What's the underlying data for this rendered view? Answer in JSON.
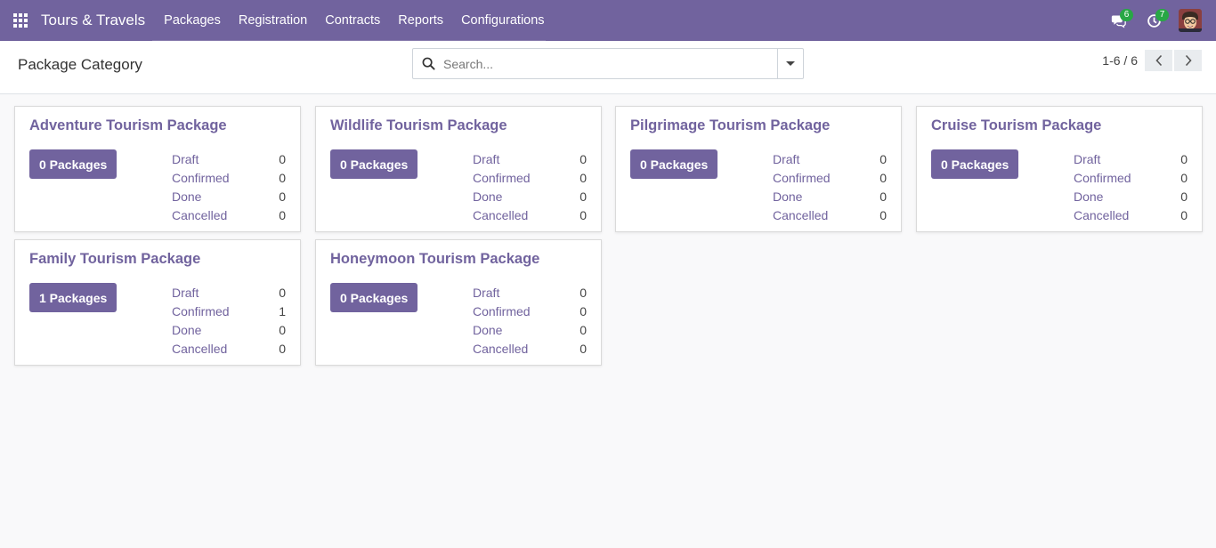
{
  "navbar": {
    "brand": "Tours & Travels",
    "menu": [
      "Packages",
      "Registration",
      "Contracts",
      "Reports",
      "Configurations"
    ],
    "messages_badge": "6",
    "activities_badge": "7"
  },
  "control_panel": {
    "title": "Package Category",
    "search_placeholder": "Search...",
    "pager": "1-6 / 6"
  },
  "stat_labels": {
    "draft": "Draft",
    "confirmed": "Confirmed",
    "done": "Done",
    "cancelled": "Cancelled"
  },
  "cards": [
    {
      "title": "Adventure Tourism Package",
      "button": "0 Packages",
      "draft": "0",
      "confirmed": "0",
      "done": "0",
      "cancelled": "0"
    },
    {
      "title": "Wildlife Tourism Package",
      "button": "0 Packages",
      "draft": "0",
      "confirmed": "0",
      "done": "0",
      "cancelled": "0"
    },
    {
      "title": "Pilgrimage Tourism Package",
      "button": "0 Packages",
      "draft": "0",
      "confirmed": "0",
      "done": "0",
      "cancelled": "0"
    },
    {
      "title": "Cruise Tourism Package",
      "button": "0 Packages",
      "draft": "0",
      "confirmed": "0",
      "done": "0",
      "cancelled": "0"
    },
    {
      "title": "Family Tourism Package",
      "button": "1 Packages",
      "draft": "0",
      "confirmed": "1",
      "done": "0",
      "cancelled": "0"
    },
    {
      "title": "Honeymoon Tourism Package",
      "button": "0 Packages",
      "draft": "0",
      "confirmed": "0",
      "done": "0",
      "cancelled": "0"
    }
  ],
  "colors": {
    "brand": "#71639e",
    "badge": "#28a745"
  }
}
